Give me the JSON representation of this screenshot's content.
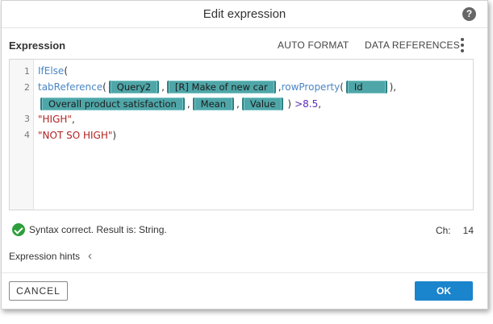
{
  "dialog": {
    "title": "Edit expression",
    "help_icon": "?"
  },
  "toolbar": {
    "label": "Expression",
    "auto_format": "AUTO FORMAT",
    "data_references": "DATA REFERENCES"
  },
  "editor": {
    "line_numbers": [
      "1",
      "2",
      "3",
      "4"
    ],
    "line1": {
      "fn": "IfElse",
      "open": "("
    },
    "line2": {
      "fn1": "tabReference",
      "open1": "(",
      "chip1": "Query2",
      "sep1": ",",
      "chip2": "[R] Make of new car",
      "sep2": ",",
      "fn2": "rowProperty",
      "open2": "(",
      "chip3": "Id",
      "close": "),"
    },
    "line2b": {
      "chip4": "Overall product satisfaction",
      "sep1": ",",
      "chip5": "Mean",
      "sep2": ",",
      "chip6": "Value",
      "close": ")",
      "op": ">",
      "num": "8.5",
      "comma": ","
    },
    "line3": {
      "str": "\"HIGH\"",
      "comma": ","
    },
    "line4": {
      "str": "\"NOT SO HIGH\"",
      "close": ")"
    }
  },
  "status": {
    "message": "Syntax correct. Result is: String.",
    "ch_label": "Ch:",
    "ch_value": "14"
  },
  "hints": {
    "label": "Expression hints",
    "chevron": "‹"
  },
  "footer": {
    "cancel": "CANCEL",
    "ok": "OK"
  },
  "colors": {
    "chip": "#4fa6a8",
    "function": "#4a86c5",
    "string": "#b22222",
    "number": "#5a2bb5",
    "ok_button": "#1a84cc",
    "success": "#2e9e3c"
  }
}
